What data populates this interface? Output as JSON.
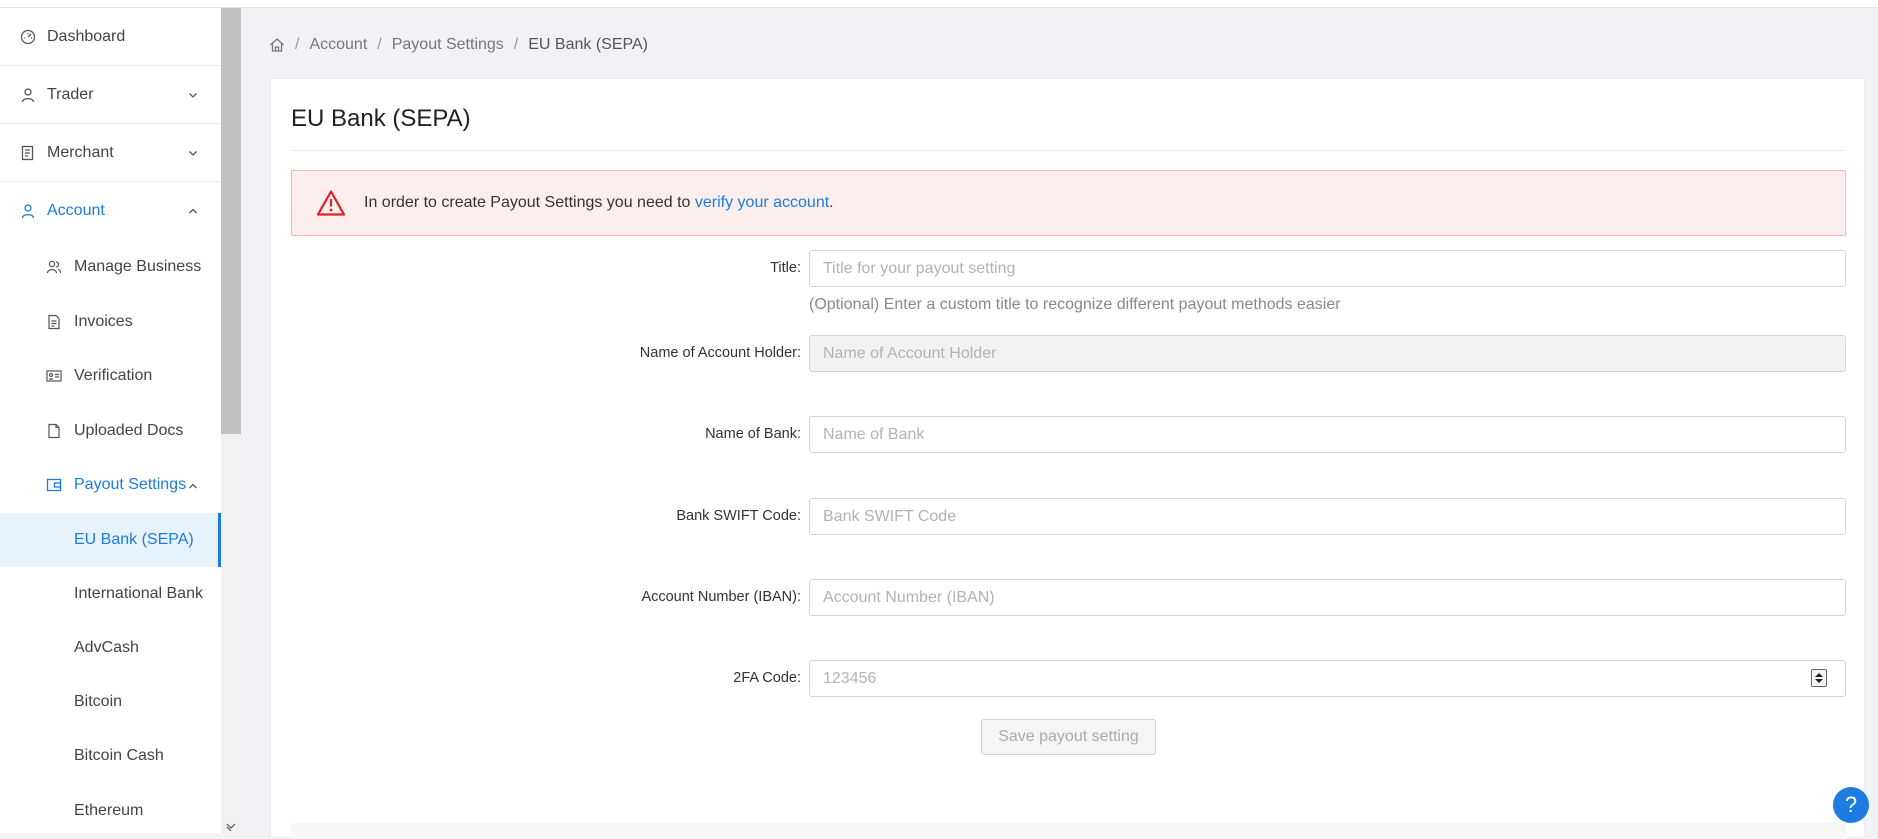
{
  "sidebar": {
    "dashboard": "Dashboard",
    "trader": "Trader",
    "merchant": "Merchant",
    "account": "Account",
    "account_children": {
      "manage_business": "Manage Business",
      "invoices": "Invoices",
      "verification": "Verification",
      "uploaded_docs": "Uploaded Docs",
      "payout_settings": "Payout Settings"
    },
    "payout_children": [
      "EU Bank (SEPA)",
      "International Bank",
      "AdvCash",
      "Bitcoin",
      "Bitcoin Cash",
      "Ethereum"
    ]
  },
  "breadcrumb": {
    "items": [
      "Account",
      "Payout Settings",
      "EU Bank (SEPA)"
    ],
    "separator": "/"
  },
  "page": {
    "title": "EU Bank (SEPA)"
  },
  "alert": {
    "text_before": "In order to create Payout Settings you need to ",
    "link": "verify your account",
    "text_after": "."
  },
  "form": {
    "title": {
      "label": "Title",
      "placeholder": "Title for your payout setting",
      "help": "(Optional) Enter a custom title to recognize different payout methods easier"
    },
    "account_holder": {
      "label": "Name of Account Holder",
      "placeholder": "Name of Account Holder"
    },
    "bank_name": {
      "label": "Name of Bank",
      "placeholder": "Name of Bank"
    },
    "swift": {
      "label": "Bank SWIFT Code",
      "placeholder": "Bank SWIFT Code"
    },
    "iban": {
      "label": "Account Number (IBAN)",
      "placeholder": "Account Number (IBAN)"
    },
    "twofa": {
      "label": "2FA Code",
      "placeholder": "123456"
    },
    "label_suffix": ":",
    "save_label": "Save payout setting"
  },
  "help_fab": "?",
  "colors": {
    "accent": "#1e7be0",
    "alert_bg": "#fdeeee",
    "alert_border": "#f3b4b2",
    "warning_icon": "#e0202a"
  }
}
